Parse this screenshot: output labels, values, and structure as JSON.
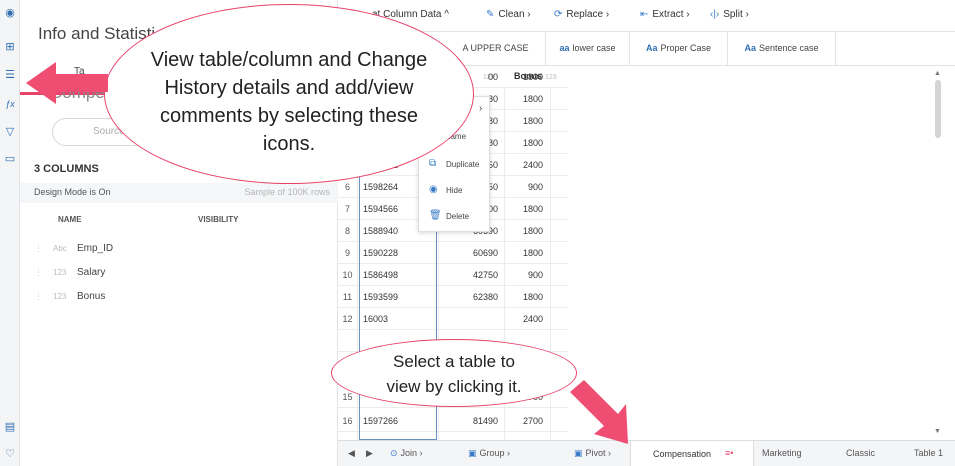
{
  "info_panel": {
    "title": "Info and Statisti",
    "tab_partial": "Ta",
    "sheet_name_partial": "Compen",
    "source_label": "Source: W",
    "columns_heading": "3 COLUMNS",
    "design_mode": "Design Mode is On",
    "sample_note": "Sample of 100K rows",
    "col_header_name": "NAME",
    "col_header_visibility": "VISIBILITY",
    "fields": [
      {
        "type": "Abc",
        "name": "Emp_ID"
      },
      {
        "type": "123",
        "name": "Salary"
      },
      {
        "type": "123",
        "name": "Bonus"
      }
    ]
  },
  "toolbar": {
    "format_label": "at Column Data ^",
    "clean_label": "Clean ›",
    "replace_label": "Replace ›",
    "extract_label": "Extract ›",
    "split_label": "Split ›"
  },
  "case_bar": {
    "upper": "A UPPER CASE",
    "lower": "lower case",
    "lower_icon": "aa",
    "proper": "Proper Case",
    "sentence": "Sentence case",
    "aa_icon": "Aa"
  },
  "grid": {
    "header_c2_type": "121",
    "header_c3": "Bonus",
    "header_c3_type": "123",
    "rows": [
      {
        "n": "",
        "c1": "",
        "c2": "00",
        "c3": "1800"
      },
      {
        "n": "",
        "c1": "",
        "c2": "80",
        "c3": "1800"
      },
      {
        "n": "",
        "c1": "",
        "c2": "80",
        "c3": "1800"
      },
      {
        "n": "",
        "c1": "1593309",
        "c2": "80",
        "c3": "1800"
      },
      {
        "n": "5",
        "c1": "1601562",
        "c2": "50",
        "c3": "2400"
      },
      {
        "n": "6",
        "c1": "1598264",
        "c2": "50",
        "c3": "900"
      },
      {
        "n": "7",
        "c1": "1594566",
        "c2": "00",
        "c3": "1800"
      },
      {
        "n": "8",
        "c1": "1588940",
        "c2": "60690",
        "c3": "1800"
      },
      {
        "n": "9",
        "c1": "1590228",
        "c2": "60690",
        "c3": "1800"
      },
      {
        "n": "10",
        "c1": "1586498",
        "c2": "42750",
        "c3": "900"
      },
      {
        "n": "11",
        "c1": "1593599",
        "c2": "62380",
        "c3": "1800"
      },
      {
        "n": "12",
        "c1": "16003",
        "c2": "",
        "c3": "2400"
      },
      {
        "n": "",
        "c1": "",
        "c2": "",
        "c3": ""
      },
      {
        "n": "",
        "c1": "",
        "c2": "",
        "c3": ""
      },
      {
        "n": "15",
        "c1": "",
        "c2": "",
        "c3": "2700"
      },
      {
        "n": "16",
        "c1": "1597266",
        "c2": "81490",
        "c3": "2700"
      }
    ]
  },
  "context_menu": {
    "items": [
      {
        "icon": "›",
        "label": ""
      },
      {
        "icon": "",
        "label": "name"
      },
      {
        "icon": "⧉",
        "label": "Duplicate"
      },
      {
        "icon": "◉",
        "label": "Hide"
      },
      {
        "icon": "🗑",
        "label": "Delete"
      }
    ]
  },
  "bottom_bar": {
    "join": "Join ›",
    "group": "Group ›",
    "pivot": "Pivot ›",
    "compensation": "Compensation",
    "compensation_mark": "≡•",
    "marketing": "Marketing",
    "classic": "Classic",
    "table1": "Table 1"
  },
  "annotations": {
    "bubble1": [
      "View table/column and Change",
      "History details and add/view",
      "comments by selecting these",
      "icons."
    ],
    "bubble2": [
      "Select a table to",
      "view by clicking it."
    ]
  },
  "colors": {
    "accent": "#e8436a",
    "link": "#2f6fb2"
  }
}
